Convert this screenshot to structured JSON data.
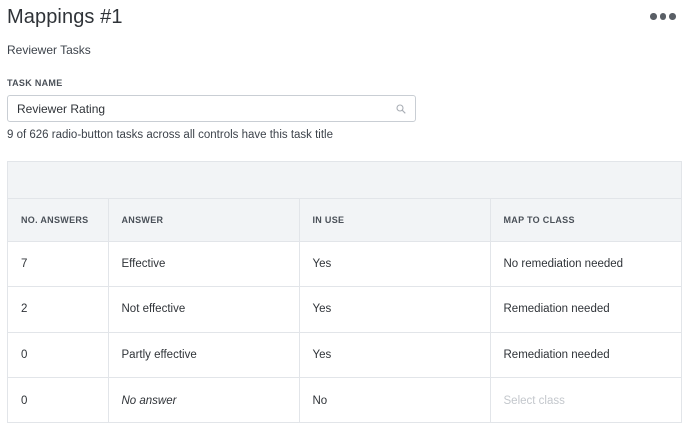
{
  "header": {
    "title": "Mappings #1",
    "more_icon": "more-horizontal-icon"
  },
  "subtitle": "Reviewer Tasks",
  "task": {
    "label": "TASK NAME",
    "value": "Reviewer Rating",
    "search_icon": "search-icon"
  },
  "helper_text": "9 of 626 radio-button tasks across all controls have this task title",
  "table": {
    "columns": [
      "NO. ANSWERS",
      "ANSWER",
      "IN USE",
      "MAP TO CLASS"
    ],
    "rows": [
      {
        "count": "7",
        "answer": "Effective",
        "in_use": "Yes",
        "class": "No remediation needed"
      },
      {
        "count": "2",
        "answer": "Not effective",
        "in_use": "Yes",
        "class": "Remediation needed"
      },
      {
        "count": "0",
        "answer": "Partly effective",
        "in_use": "Yes",
        "class": "Remediation needed"
      },
      {
        "count": "0",
        "answer": "No answer",
        "in_use": "No",
        "class_placeholder": "Select class"
      }
    ]
  }
}
